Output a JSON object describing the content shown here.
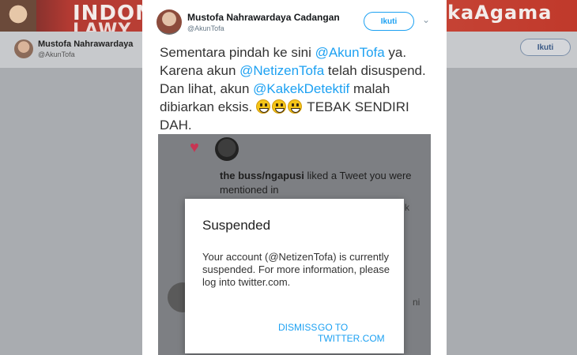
{
  "background": {
    "banner_left": "INDON",
    "banner_left_2": "LAWY",
    "banner_right": "ukaAgama",
    "profile_name": "Mustofa Nahrawardaya",
    "profile_handle": "@AkunTofa",
    "follow_label": "Ikuti"
  },
  "tweet": {
    "author_name": "Mustofa Nahrawardaya Cadangan",
    "author_handle": "@AkunTofa",
    "follow_label": "Ikuti",
    "caret": "⌄",
    "text_1": "Sementara pindah ke sini ",
    "mention_1": "@AkunTofa",
    "text_2": " ya. Karena akun ",
    "mention_2": "@NetizenTofa",
    "text_3": " telah disuspend. Dan lihat, akun ",
    "mention_3": "@KakekDetektif",
    "text_4": " malah dibiarkan eksis. ",
    "text_5": " TEBAK SENDIRI DAH."
  },
  "screenshot": {
    "notice_user": "the buss/ngapusi",
    "notice_text": " liked a Tweet you were mentioned in",
    "fragment_1": "k",
    "fragment_2": "ni",
    "dialog": {
      "title": "Suspended",
      "body": "Your account (@NetizenTofa) is currently suspended. For more information, please log into twitter.com.",
      "dismiss_label": "DISMISS",
      "goto_label": "GO TO TWITTER.COM"
    }
  },
  "colors": {
    "link": "#1da1f2",
    "heart": "#c73553",
    "banner": "#c0392b"
  }
}
